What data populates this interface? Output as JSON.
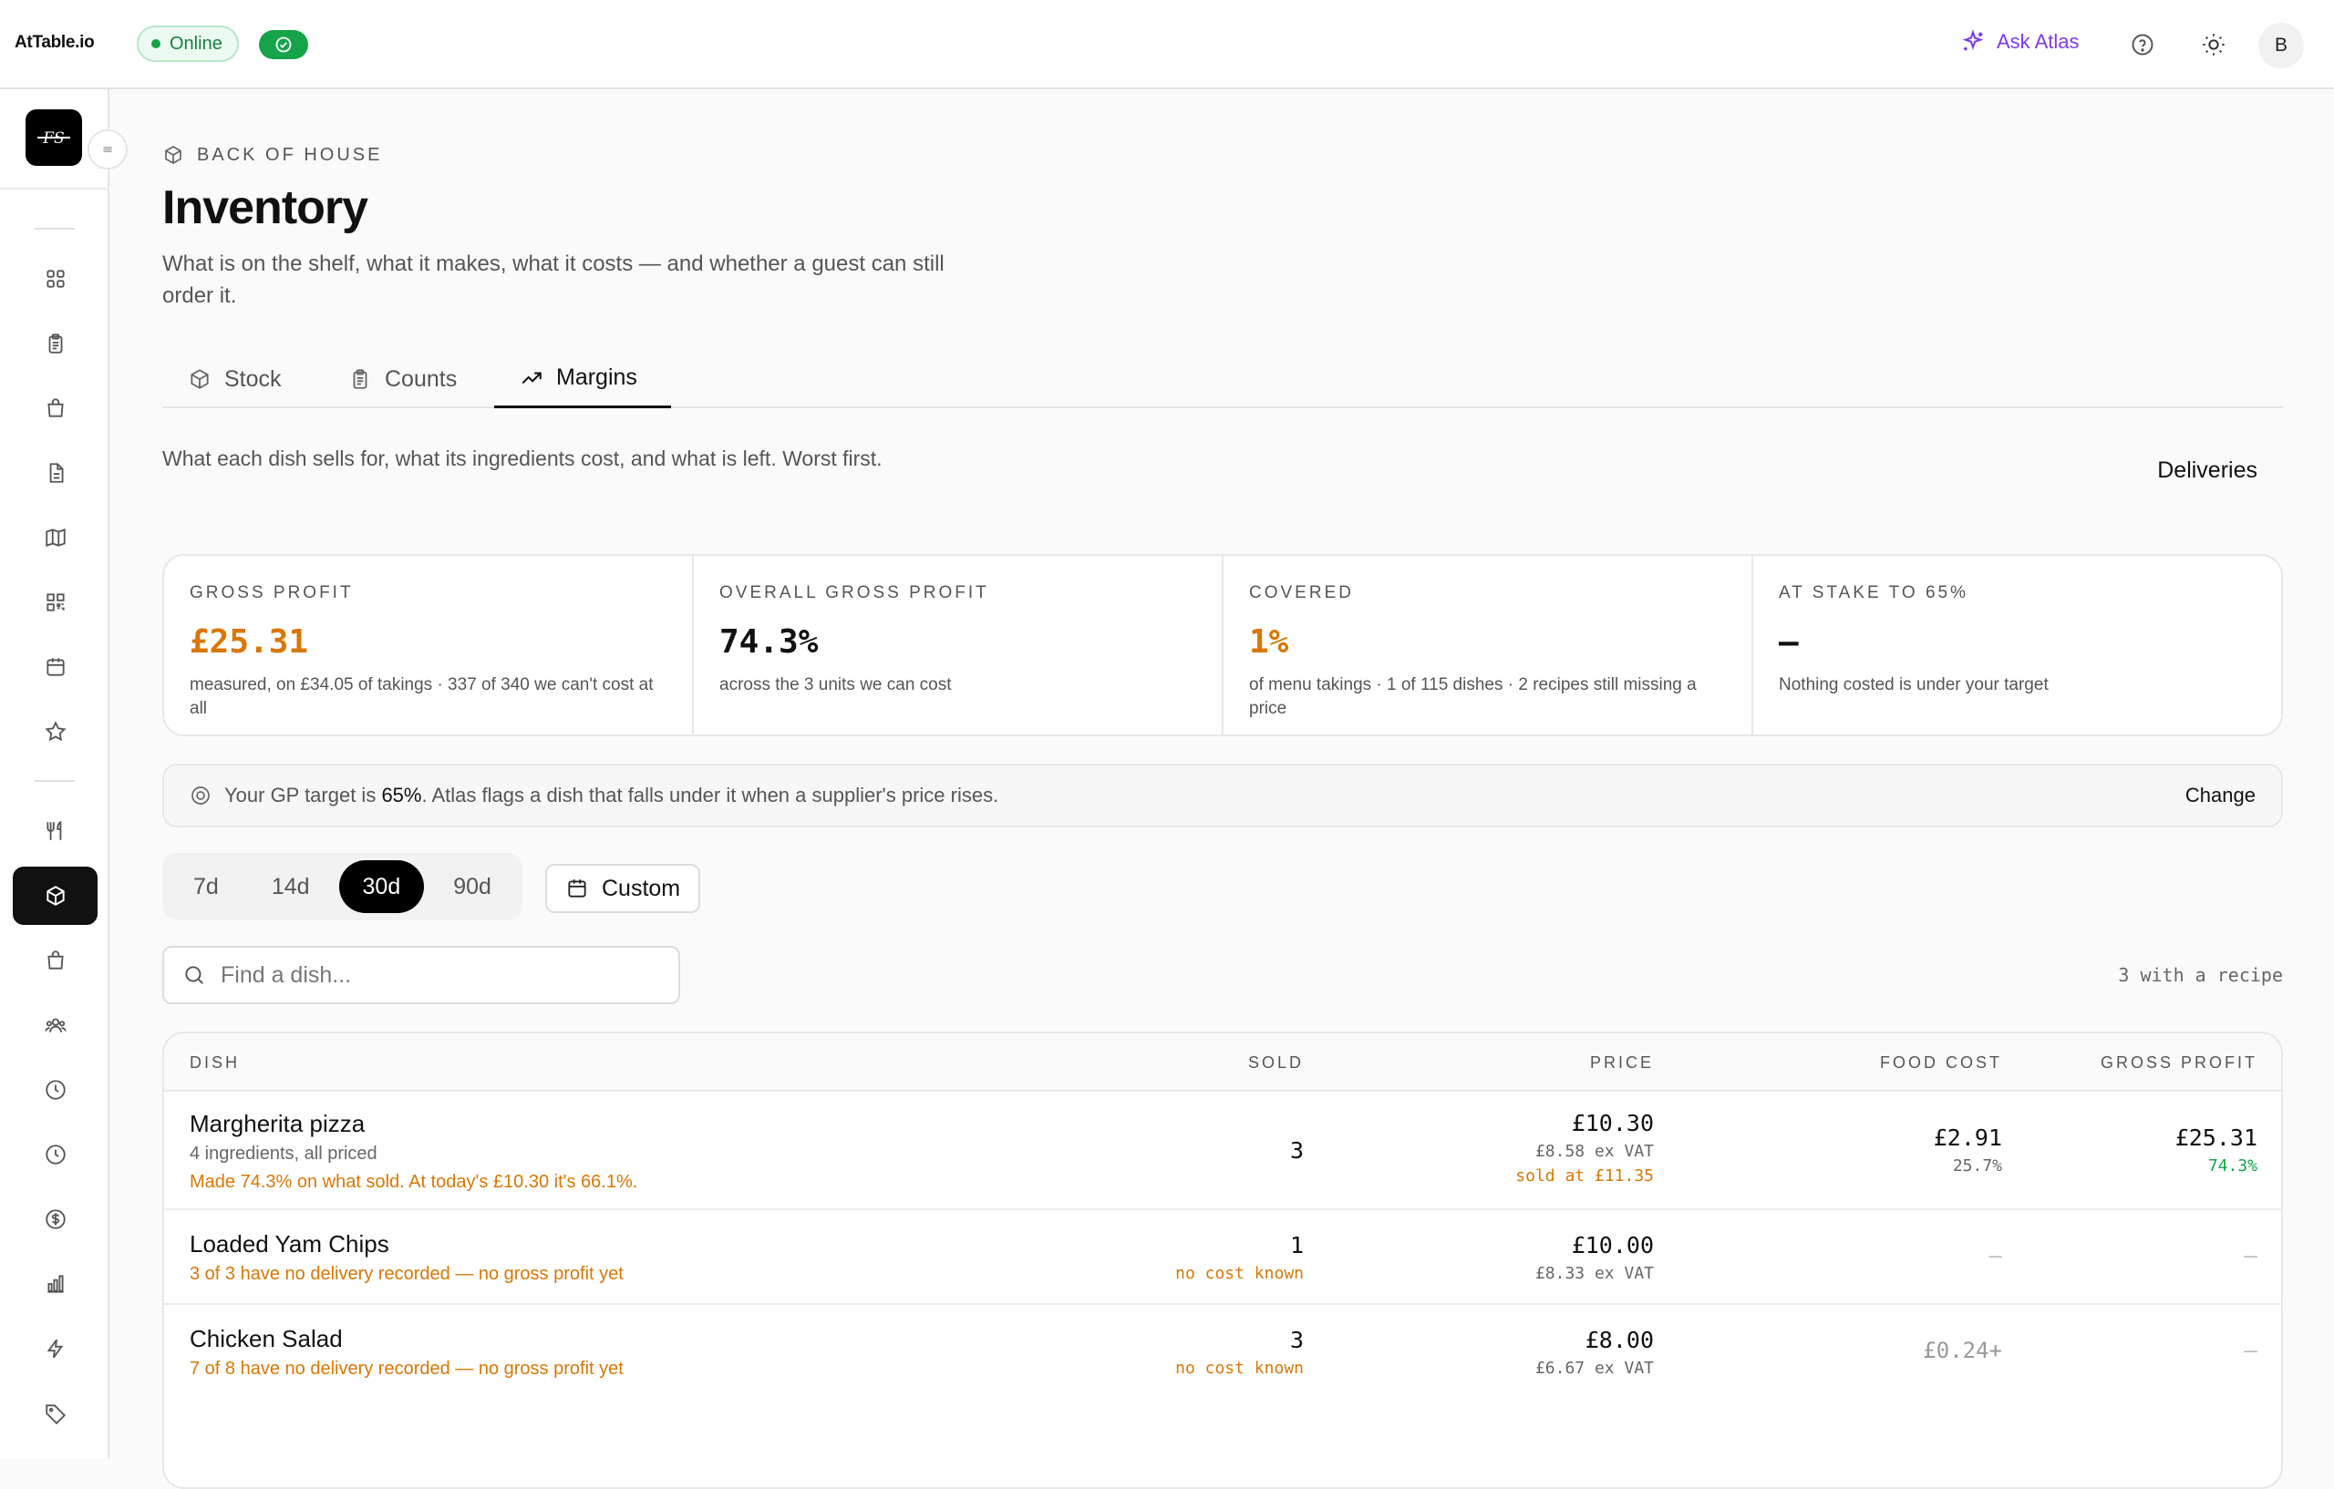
{
  "app": {
    "brand": "AtTable.io",
    "status": "Online",
    "ask_label": "Ask Atlas",
    "avatar": "B",
    "venue_initials": "FS",
    "colors": {
      "accent": "#7c3aed",
      "online": "#16a34a",
      "warning": "#d97706",
      "active_nav": "#111111"
    }
  },
  "page": {
    "eyebrow": "BACK OF HOUSE",
    "title": "Inventory",
    "subtitle": "What is on the shelf, what it makes, what it costs — and whether a guest can still order it."
  },
  "tabs": [
    {
      "label": "Stock",
      "icon": "box-icon"
    },
    {
      "label": "Counts",
      "icon": "clipboard-icon"
    },
    {
      "label": "Margins",
      "icon": "trending-up-icon",
      "active": true
    }
  ],
  "margins": {
    "description": "What each dish sells for, what its ingredients cost, and what is left. Worst first.",
    "deliveries_label": "Deliveries"
  },
  "kpis": [
    {
      "label": "GROSS PROFIT",
      "value": "£25.31",
      "note": "measured, on £34.05 of takings · 337 of 340 we can't cost at all"
    },
    {
      "label": "OVERALL GROSS PROFIT",
      "value": "74.3%",
      "note": "across the 3 units we can cost"
    },
    {
      "label": "COVERED",
      "value": "1%",
      "note": "of menu takings · 1 of 115 dishes · 2 recipes still missing a price"
    },
    {
      "label": "AT STAKE TO 65%",
      "value": "–",
      "note": "Nothing costed is under your target"
    }
  ],
  "gp_target": {
    "prefix": "Your GP target is ",
    "value": "65%",
    "suffix": ". Atlas flags a dish that falls under it when a supplier's price rises.",
    "change_label": "Change"
  },
  "ranges": [
    "7d",
    "14d",
    "30d",
    "90d"
  ],
  "active_range": "30d",
  "custom_label": "Custom",
  "search": {
    "placeholder": "Find a dish...",
    "value": ""
  },
  "recipe_count": "3 with a recipe",
  "table": {
    "headers": {
      "dish": "DISH",
      "sold": "SOLD",
      "price": "PRICE",
      "food_cost": "FOOD COST",
      "gross_profit": "GROSS PROFIT"
    },
    "rows": [
      {
        "name": "Margherita pizza",
        "sub": "4 ingredients, all priced",
        "warn": "Made 74.3% on what sold. At today's £10.30 it's 66.1%.",
        "sold": "3",
        "sold_note": "",
        "price": "£10.30",
        "price_ex_vat": "£8.58 ex VAT",
        "price_note": "sold at £11.35",
        "food_cost": "£2.91",
        "food_cost_pct": "25.7%",
        "gp": "£25.31",
        "gp_pct": "74.3%"
      },
      {
        "name": "Loaded Yam Chips",
        "warn": "3 of 3 have no delivery recorded — no gross profit yet",
        "sold": "1",
        "sold_note": "no cost known",
        "price": "£10.00",
        "price_ex_vat": "£8.33 ex VAT",
        "food_cost": "–",
        "gp": "–"
      },
      {
        "name": "Chicken Salad",
        "warn": "7 of 8 have no delivery recorded — no gross profit yet",
        "sold": "3",
        "sold_note": "no cost known",
        "price": "£8.00",
        "price_ex_vat": "£6.67 ex VAT",
        "food_cost": "£0.24+",
        "gp": "–"
      }
    ]
  }
}
